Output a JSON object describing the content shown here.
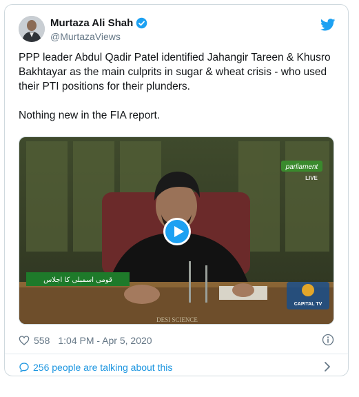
{
  "author": {
    "name": "Murtaza Ali Shah",
    "handle": "@MurtazaViews",
    "verified": true
  },
  "tweet": {
    "paragraphs": [
      "PPP leader Abdul Qadir Patel identified Jahangir Tareen & Khusro Bakhtayar as the main culprits in sugar & wheat crisis - who used their PTI positions for their plunders.",
      "Nothing new in the FIA report."
    ]
  },
  "video": {
    "overlay_top_logo": "parliament",
    "overlay_live": "LIVE",
    "overlay_ticker": "قومی اسمبلی کا اجلاس",
    "overlay_watermark": "DESI SCIENCE",
    "overlay_channel": "CAPITAL TV"
  },
  "meta": {
    "likes": "558",
    "timestamp": "1:04 PM - Apr 5, 2020"
  },
  "conversation": {
    "label": "256 people are talking about this"
  },
  "colors": {
    "accent": "#1da1f2",
    "link": "#1b95e0",
    "muted": "#657786"
  },
  "icons": [
    "verified-icon",
    "twitter-bird-icon",
    "play-icon",
    "heart-icon",
    "info-icon",
    "chat-bubble-icon",
    "chevron-right-icon"
  ]
}
